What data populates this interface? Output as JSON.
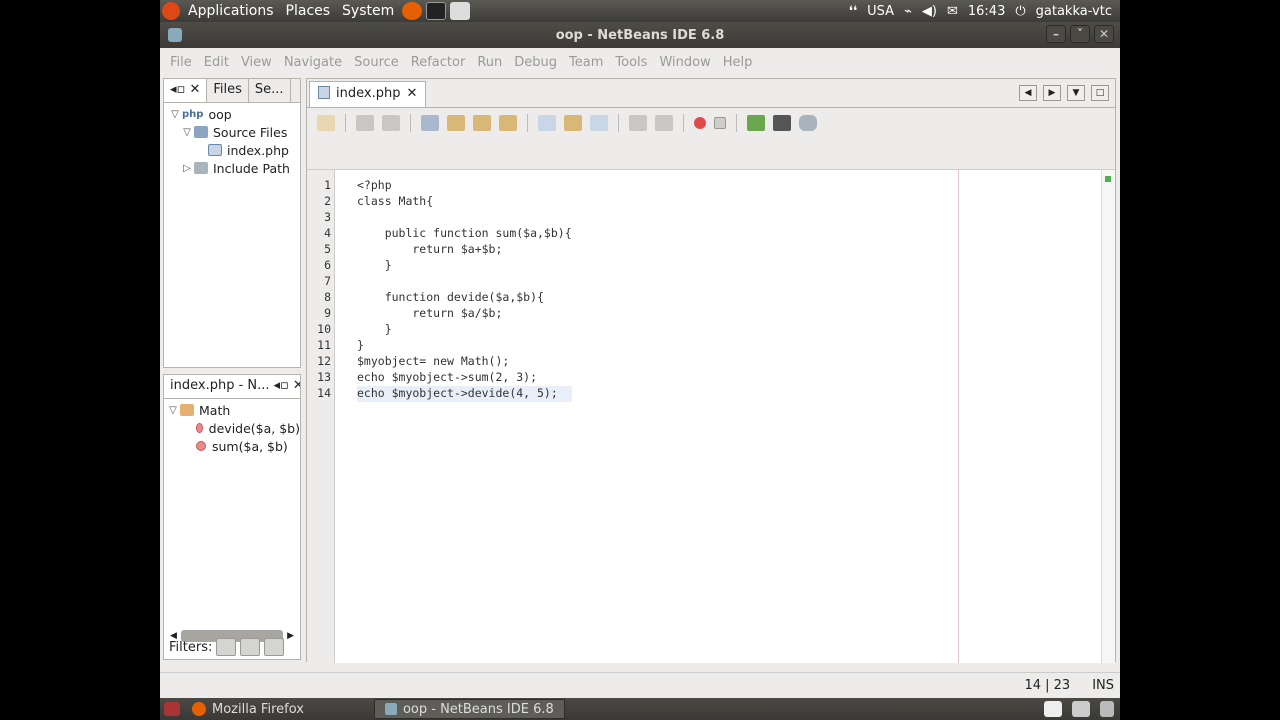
{
  "topPanel": {
    "menus": [
      "Applications",
      "Places",
      "System"
    ],
    "keyboard": "USA",
    "clock": "16:43",
    "user": "gatakka-vtc"
  },
  "window": {
    "title": "oop - NetBeans IDE 6.8"
  },
  "menubar": [
    "File",
    "Edit",
    "View",
    "Navigate",
    "Source",
    "Refactor",
    "Run",
    "Debug",
    "Team",
    "Tools",
    "Window",
    "Help"
  ],
  "projectPane": {
    "tabs": [
      "Files",
      "Se..."
    ],
    "tree": [
      {
        "label": "oop",
        "prefix": "php"
      },
      {
        "label": "Source Files"
      },
      {
        "label": "index.php"
      },
      {
        "label": "Include Path"
      }
    ]
  },
  "navigatorPane": {
    "title": "index.php - N...",
    "class": "Math",
    "methods": [
      "devide($a, $b)",
      "sum($a, $b)"
    ],
    "filters_label": "Filters:"
  },
  "editor": {
    "tab": "index.php",
    "lines": [
      "<?php",
      "class Math{",
      "",
      "    public function sum($a,$b){",
      "        return $a+$b;",
      "    }",
      "",
      "    function devide($a,$b){",
      "        return $a/$b;",
      "    }",
      "}",
      "$myobject= new Math();",
      "echo $myobject->sum(2, 3);",
      "echo $myobject->devide(4, 5);"
    ],
    "current_line": 14
  },
  "statusbar": {
    "position": "14 | 23",
    "mode": "INS"
  },
  "taskbar": {
    "tasks": [
      "Mozilla Firefox",
      "oop - NetBeans IDE 6.8"
    ]
  }
}
